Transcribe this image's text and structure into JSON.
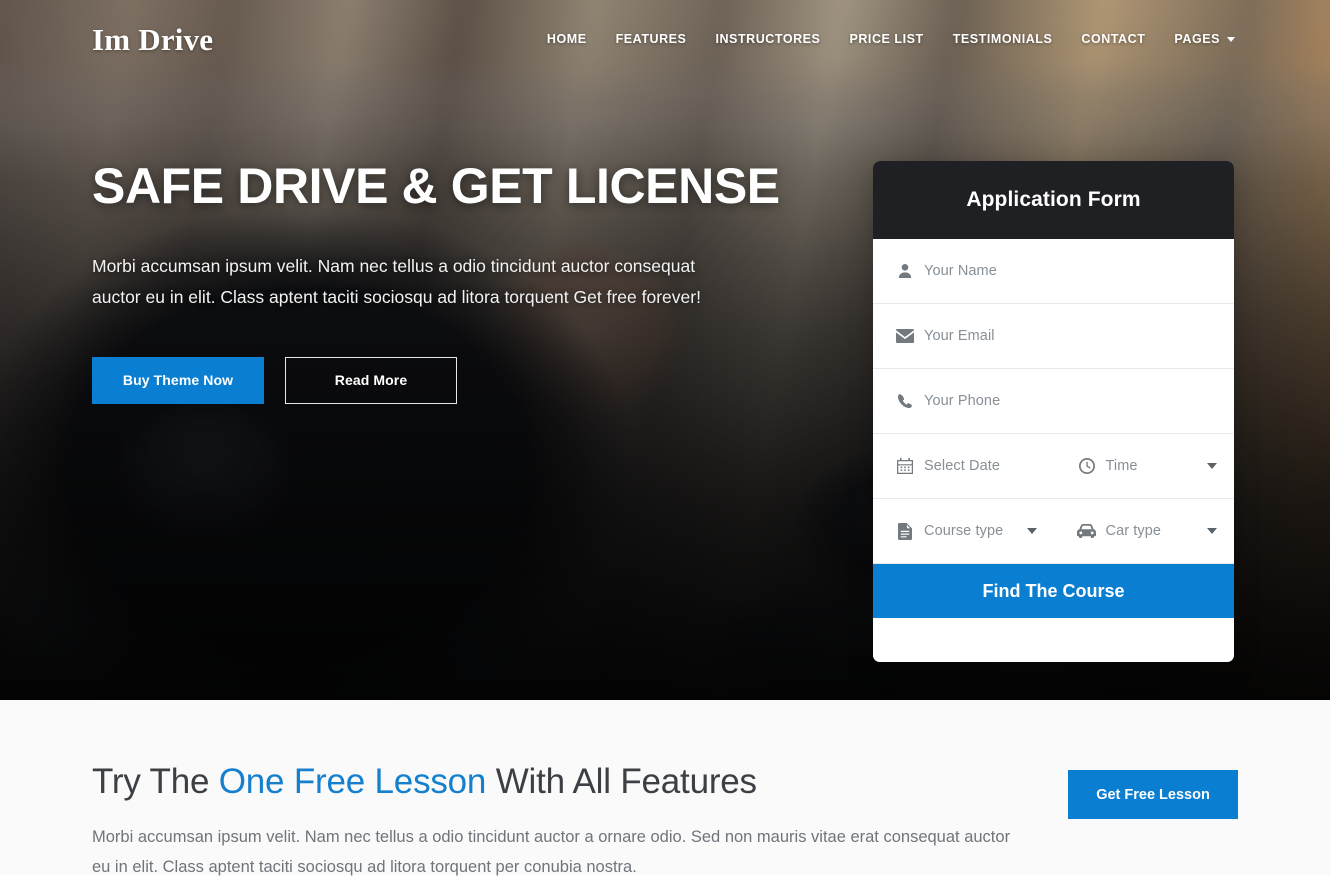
{
  "header": {
    "logo": "Im Drive",
    "nav": [
      {
        "label": "HOME",
        "has_caret": false
      },
      {
        "label": "FEATURES",
        "has_caret": false
      },
      {
        "label": "INSTRUCTORES",
        "has_caret": false
      },
      {
        "label": "PRICE LIST",
        "has_caret": false
      },
      {
        "label": "TESTIMONIALS",
        "has_caret": false
      },
      {
        "label": "CONTACT",
        "has_caret": false
      },
      {
        "label": "PAGES",
        "has_caret": true
      }
    ]
  },
  "hero": {
    "title": "SAFE DRIVE & GET LICENSE",
    "text": "Morbi accumsan ipsum velit. Nam nec tellus a odio tincidunt auctor consequat auctor eu in elit. Class aptent taciti sociosqu ad litora torquent Get free forever!",
    "primary_button": "Buy Theme Now",
    "outline_button": "Read More"
  },
  "form": {
    "title": "Application Form",
    "fields": {
      "name_placeholder": "Your Name",
      "email_placeholder": "Your Email",
      "phone_placeholder": "Your Phone",
      "date_placeholder": "Select Date",
      "time_placeholder": "Time",
      "course_placeholder": "Course type",
      "car_placeholder": "Car type"
    },
    "icons": {
      "name": "user-icon",
      "email": "envelope-icon",
      "phone": "phone-icon",
      "date": "calendar-icon",
      "time": "clock-icon",
      "course": "document-icon",
      "car": "car-icon"
    },
    "submit_label": "Find The Course"
  },
  "feature": {
    "title_pre": "Try The ",
    "title_highlight": "One Free Lesson",
    "title_post": " With All Features",
    "text": "Morbi accumsan ipsum velit. Nam nec tellus a odio tincidunt auctor a ornare odio. Sed non mauris vitae erat consequat auctor eu in elit. Class aptent taciti sociosqu ad litora torquent per conubia nostra.",
    "button": "Get Free Lesson"
  },
  "colors": {
    "accent_blue": "#0a7fd1",
    "highlight_blue": "#1580cd",
    "form_header_dark": "#1f2023",
    "section_bg": "#fafafa",
    "placeholder_gray": "#878f96"
  }
}
